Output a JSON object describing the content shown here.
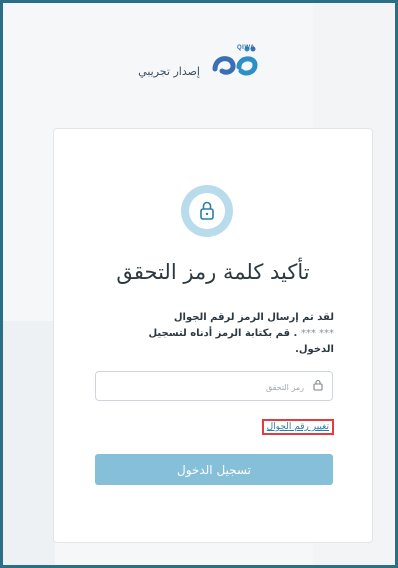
{
  "header": {
    "brand_small": "QIWA",
    "subtitle": "إصدار تجريبي"
  },
  "card": {
    "title": "تأكيد كلمة رمز التحقق",
    "description_line1": "لقد تم إرسال الرمز لرقم الجوال",
    "masked_number": "*** ***",
    "description_line2": ". قم بكتابة الرمز أدناه لتسجيل",
    "description_line3": "الدخول.",
    "otp_placeholder": "رمز التحقق",
    "change_number_link": "تغيير رقم الجوال",
    "login_button": "تسجيل الدخول"
  },
  "colors": {
    "frame_border": "#2a6f86",
    "accent_button": "#86bfd8",
    "lock_circle": "#b9dcec",
    "link": "#2c7ea9",
    "highlight_box": "#e23c3c"
  },
  "icons": {
    "lock": "lock-icon",
    "input_lock": "lock-icon"
  }
}
